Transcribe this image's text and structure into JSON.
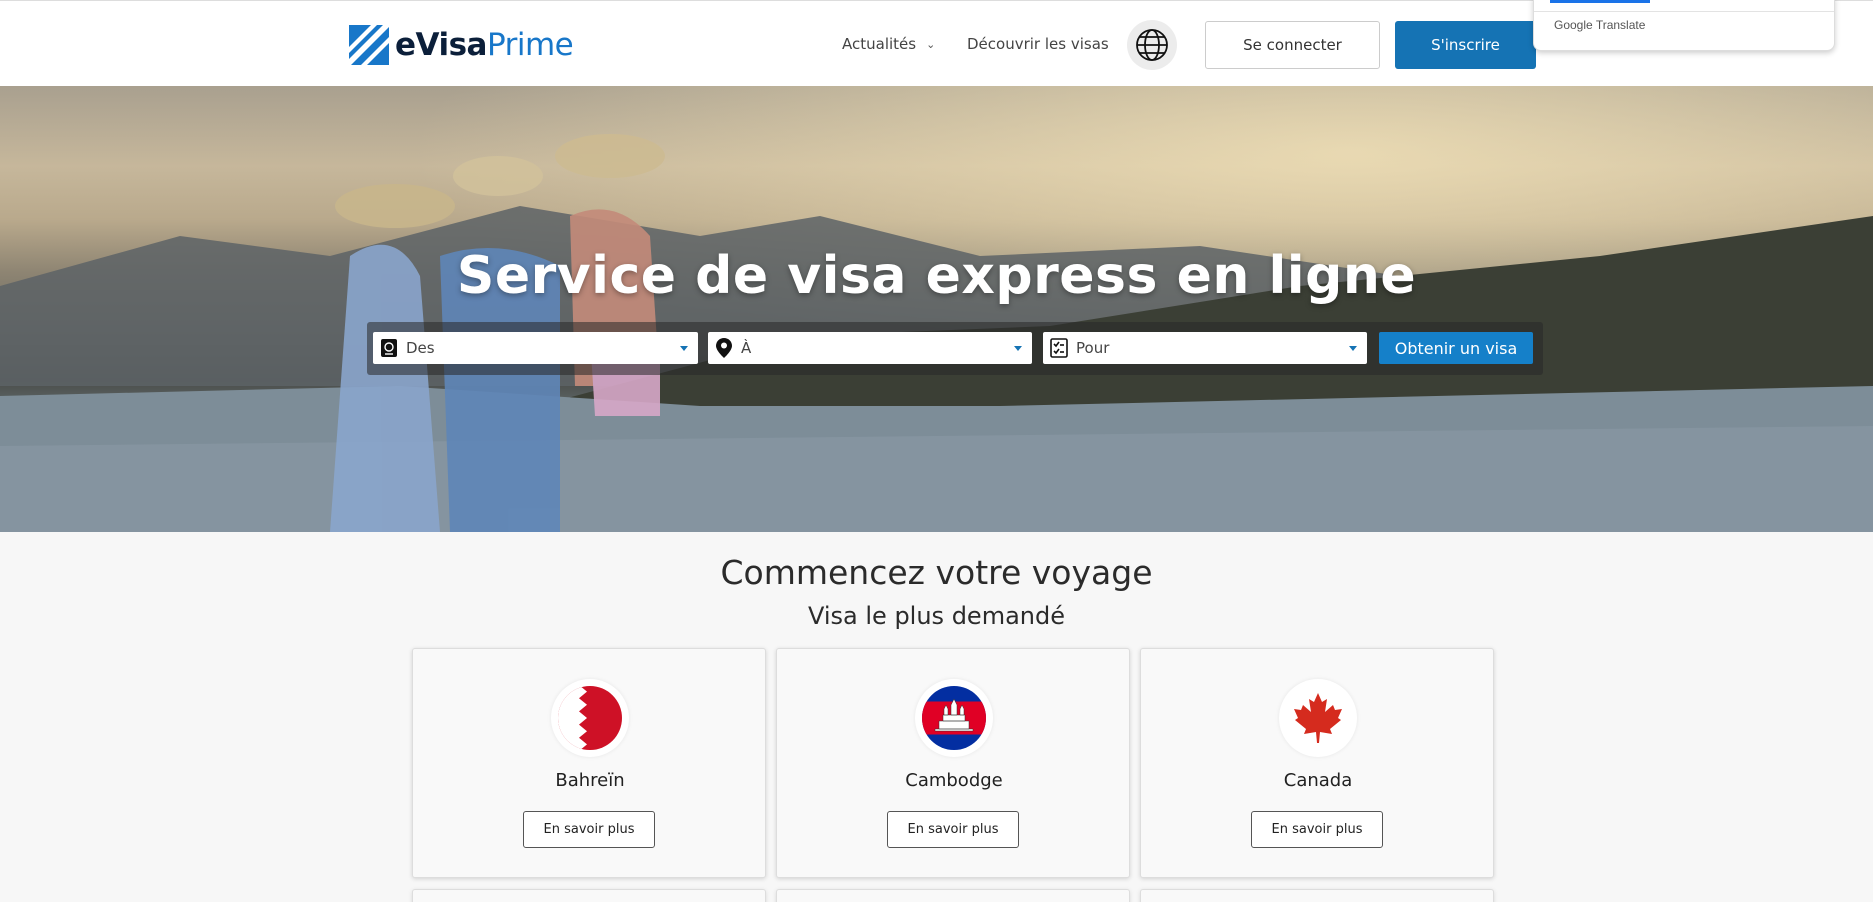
{
  "header": {
    "logo": {
      "brand_main": "eVisa",
      "brand_accent": "Prime"
    },
    "nav": {
      "news_label": "Actualités",
      "discover_label": "Découvrir les visas"
    },
    "language_icon": "globe-icon",
    "login_label": "Se connecter",
    "signup_label": "S'inscrire"
  },
  "google_translate": {
    "label": "Google Translate"
  },
  "hero": {
    "title": "Service de visa express en ligne",
    "search": {
      "from": {
        "placeholder": "Des",
        "icon": "passport-icon"
      },
      "to": {
        "placeholder": "À",
        "icon": "location-pin-icon"
      },
      "purpose": {
        "placeholder": "Pour",
        "icon": "checklist-icon"
      },
      "submit_label": "Obtenir un visa"
    }
  },
  "section": {
    "title": "Commencez votre voyage",
    "subtitle": "Visa le plus demandé",
    "cards": [
      {
        "country": "Bahreïn",
        "button": "En savoir plus",
        "flag": "bahrain-flag"
      },
      {
        "country": "Cambodge",
        "button": "En savoir plus",
        "flag": "cambodia-flag"
      },
      {
        "country": "Canada",
        "button": "En savoir plus",
        "flag": "canada-flag"
      }
    ]
  },
  "colors": {
    "primary": "#1573b4",
    "button_blue": "#1580c9",
    "brand_dark": "#0b1f3a",
    "brand_accent": "#1877c9"
  }
}
